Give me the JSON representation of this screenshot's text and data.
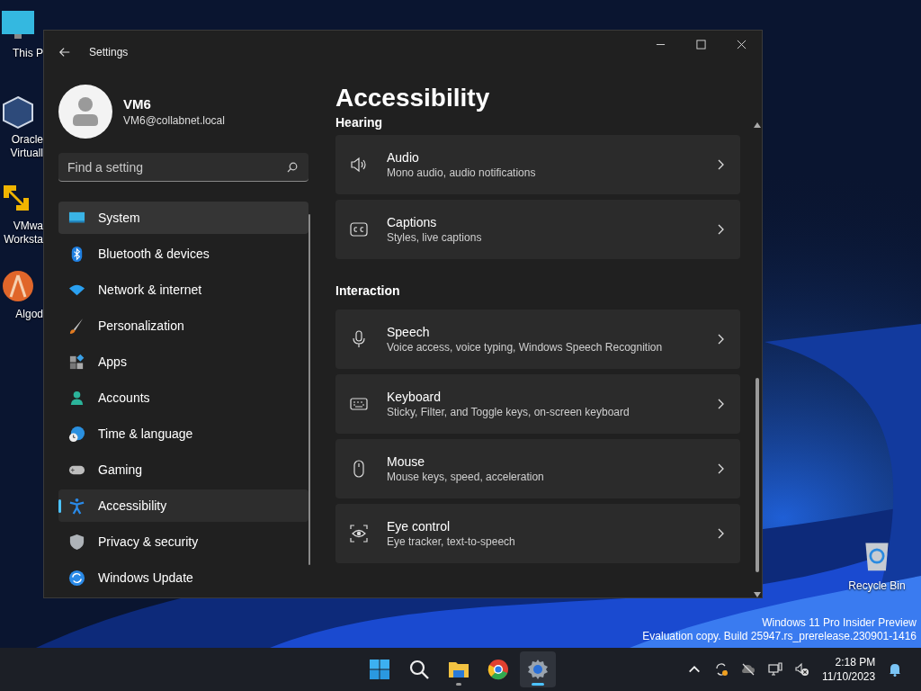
{
  "desktop_icons": [
    {
      "lines": [
        "This P"
      ]
    },
    {
      "lines": [
        "Oracle",
        "Virtuall"
      ]
    },
    {
      "lines": [
        "VMwa",
        "Worksta"
      ]
    },
    {
      "lines": [
        "Algod"
      ]
    }
  ],
  "recycle_bin": {
    "label": "Recycle Bin"
  },
  "window": {
    "title": "Settings"
  },
  "profile": {
    "name": "VM6",
    "email": "VM6@collabnet.local"
  },
  "search": {
    "placeholder": "Find a setting"
  },
  "nav": [
    {
      "label": "System",
      "selected": false,
      "hovered": true
    },
    {
      "label": "Bluetooth & devices",
      "selected": false,
      "hovered": false
    },
    {
      "label": "Network & internet",
      "selected": false,
      "hovered": false
    },
    {
      "label": "Personalization",
      "selected": false,
      "hovered": false
    },
    {
      "label": "Apps",
      "selected": false,
      "hovered": false
    },
    {
      "label": "Accounts",
      "selected": false,
      "hovered": false
    },
    {
      "label": "Time & language",
      "selected": false,
      "hovered": false
    },
    {
      "label": "Gaming",
      "selected": false,
      "hovered": false
    },
    {
      "label": "Accessibility",
      "selected": true,
      "hovered": false
    },
    {
      "label": "Privacy & security",
      "selected": false,
      "hovered": false
    },
    {
      "label": "Windows Update",
      "selected": false,
      "hovered": false
    }
  ],
  "page": {
    "title": "Accessibility",
    "sections": [
      {
        "heading": "Hearing",
        "items": [
          {
            "title": "Audio",
            "subtitle": "Mono audio, audio notifications"
          },
          {
            "title": "Captions",
            "subtitle": "Styles, live captions"
          }
        ]
      },
      {
        "heading": "Interaction",
        "items": [
          {
            "title": "Speech",
            "subtitle": "Voice access, voice typing, Windows Speech Recognition"
          },
          {
            "title": "Keyboard",
            "subtitle": "Sticky, Filter, and Toggle keys, on-screen keyboard"
          },
          {
            "title": "Mouse",
            "subtitle": "Mouse keys, speed, acceleration"
          },
          {
            "title": "Eye control",
            "subtitle": "Eye tracker, text-to-speech"
          }
        ]
      }
    ]
  },
  "build_info": [
    "Windows 11 Pro Insider Preview",
    "Evaluation copy. Build 25947.rs_prerelease.230901-1416"
  ],
  "taskbar": {
    "apps": [
      {
        "running": false,
        "selected": false
      },
      {
        "running": false,
        "selected": false
      },
      {
        "running": true,
        "selected": false
      },
      {
        "running": false,
        "selected": false
      },
      {
        "running": true,
        "selected": true
      }
    ],
    "time": "2:18 PM",
    "date": "11/10/2023"
  }
}
